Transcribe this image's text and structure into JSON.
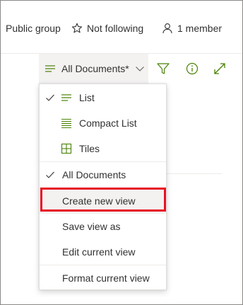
{
  "header": {
    "privacy": "Public group",
    "follow": "Not following",
    "members": "1 member"
  },
  "command_bar": {
    "view_label": "All Documents*",
    "icons": [
      "list-icon",
      "chevron-down-icon",
      "filter-icon",
      "info-icon",
      "expand-icon"
    ]
  },
  "view_menu": {
    "layouts": [
      {
        "label": "List",
        "icon": "list-icon",
        "checked": true
      },
      {
        "label": "Compact List",
        "icon": "compact-list-icon",
        "checked": false
      },
      {
        "label": "Tiles",
        "icon": "tiles-icon",
        "checked": false
      }
    ],
    "views": [
      {
        "label": "All Documents",
        "checked": true
      },
      {
        "label": "Create new view",
        "checked": false,
        "highlighted": true
      },
      {
        "label": "Save view as",
        "checked": false
      },
      {
        "label": "Edit current view",
        "checked": false
      }
    ],
    "footer": {
      "label": "Format current view"
    }
  },
  "colors": {
    "accent_green": "#498205",
    "highlight_box": "#e81123",
    "hover_bg": "#f3f2f1"
  }
}
